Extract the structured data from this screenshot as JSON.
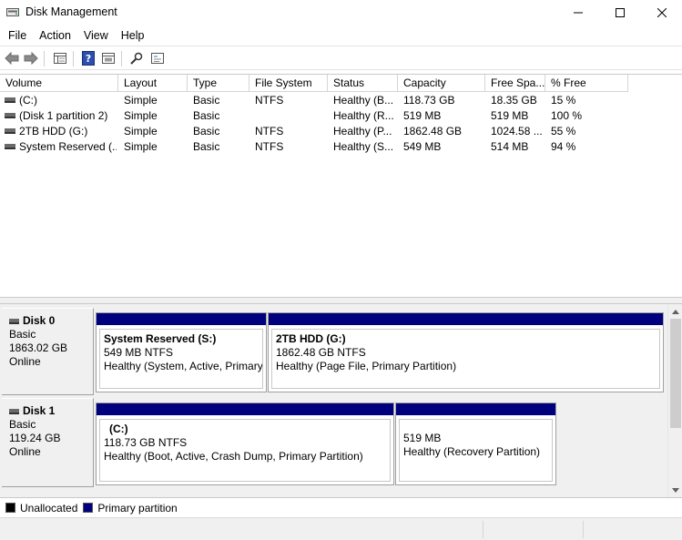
{
  "window": {
    "title": "Disk Management"
  },
  "menu": [
    "File",
    "Action",
    "View",
    "Help"
  ],
  "toolbar": [
    "back-icon",
    "forward-icon",
    "properties-icon",
    "help-icon",
    "refresh-icon",
    "rescan-icon",
    "console-icon"
  ],
  "table": {
    "columns": [
      "Volume",
      "Layout",
      "Type",
      "File System",
      "Status",
      "Capacity",
      "Free Spa...",
      "% Free"
    ],
    "rows": [
      [
        "(C:)",
        "Simple",
        "Basic",
        "NTFS",
        "Healthy (B...",
        "118.73 GB",
        "18.35 GB",
        "15 %"
      ],
      [
        "(Disk 1 partition 2)",
        "Simple",
        "Basic",
        "",
        "Healthy (R...",
        "519 MB",
        "519 MB",
        "100 %"
      ],
      [
        "2TB HDD (G:)",
        "Simple",
        "Basic",
        "NTFS",
        "Healthy (P...",
        "1862.48 GB",
        "1024.58 ...",
        "55 %"
      ],
      [
        "System Reserved (...",
        "Simple",
        "Basic",
        "NTFS",
        "Healthy (S...",
        "549 MB",
        "514 MB",
        "94 %"
      ]
    ]
  },
  "disks": [
    {
      "name": "Disk 0",
      "type": "Basic",
      "size": "1863.02 GB",
      "state": "Online",
      "partitions": [
        {
          "name": "System Reserved  (S:)",
          "size": "549 MB NTFS",
          "status": "Healthy (System, Active, Primary"
        },
        {
          "name": "2TB HDD  (G:)",
          "size": "1862.48 GB NTFS",
          "status": "Healthy (Page File, Primary Partition)"
        }
      ]
    },
    {
      "name": "Disk 1",
      "type": "Basic",
      "size": "119.24 GB",
      "state": "Online",
      "partitions": [
        {
          "name": "(C:)",
          "size": "118.73 GB NTFS",
          "status": "Healthy (Boot, Active, Crash Dump, Primary Partition)"
        },
        {
          "name": "",
          "size": "519 MB",
          "status": "Healthy (Recovery Partition)"
        }
      ]
    }
  ],
  "legend": [
    {
      "label": "Unallocated",
      "color": "#000000"
    },
    {
      "label": "Primary partition",
      "color": "#00007f"
    }
  ]
}
